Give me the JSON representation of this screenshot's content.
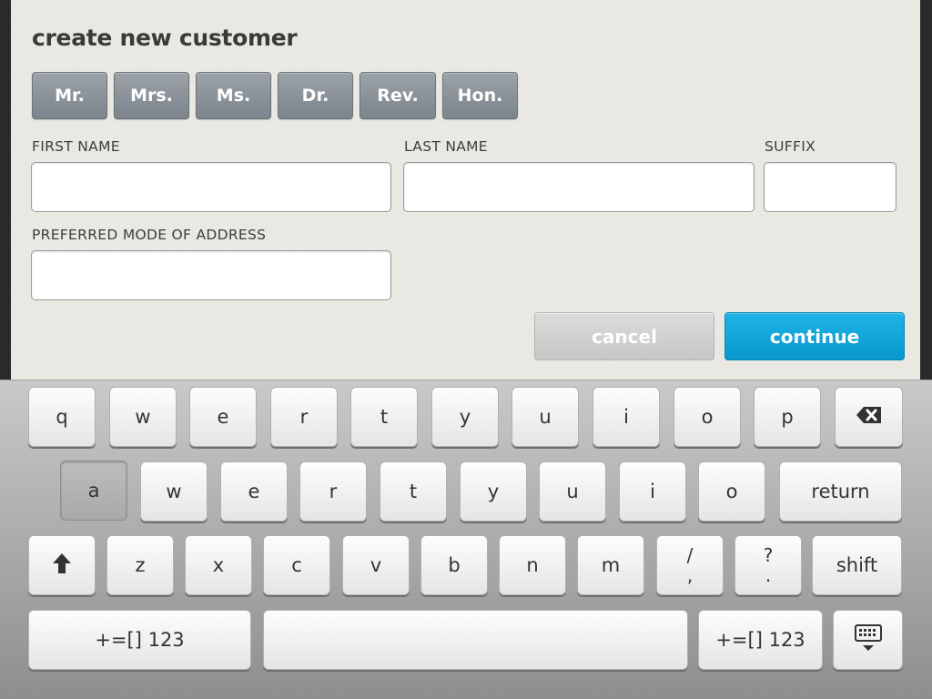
{
  "form": {
    "title": "create new customer",
    "honorifics": [
      "Mr.",
      "Mrs.",
      "Ms.",
      "Dr.",
      "Rev.",
      "Hon."
    ],
    "fields": {
      "first_name": {
        "label": "FIRST NAME",
        "value": ""
      },
      "last_name": {
        "label": "LAST NAME",
        "value": ""
      },
      "suffix": {
        "label": "SUFFIX",
        "value": ""
      },
      "preferred_address": {
        "label": "PREFERRED MODE OF ADDRESS",
        "value": ""
      }
    },
    "cancel_label": "cancel",
    "continue_label": "continue",
    "colors": {
      "continue": "#0aa4d9",
      "honorific_button": "#858d93"
    }
  },
  "keyboard": {
    "row1": [
      "q",
      "w",
      "e",
      "r",
      "t",
      "y",
      "u",
      "i",
      "o",
      "p"
    ],
    "backspace_icon": "backspace-icon",
    "row2": [
      "a",
      "w",
      "e",
      "r",
      "t",
      "y",
      "u",
      "i",
      "o"
    ],
    "pressed_key": "a",
    "return_label": "return",
    "shift_icon": "shift-arrow-icon",
    "row3": [
      "z",
      "x",
      "c",
      "v",
      "b",
      "n",
      "m"
    ],
    "slash_key": {
      "top": "/",
      "bottom": ","
    },
    "question_key": {
      "top": "?",
      "bottom": "."
    },
    "shift_label": "shift",
    "numbers_label": "+=[] 123",
    "numbers_label_right": "+=[] 123",
    "hide_keyboard_icon": "keyboard-hide-icon"
  }
}
